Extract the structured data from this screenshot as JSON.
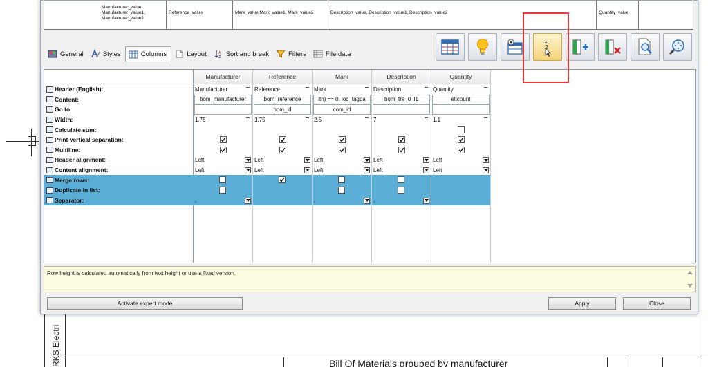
{
  "preview": {
    "manufacturer_value": "Manufacturer_value, Manufacturer_value1, Manufacturer_value2",
    "reference_value": "Reference_value",
    "mark_value": "Mark_value,Mark_value1, Mark_value2",
    "description_value": "Description_value, Description_value1, Description_value2",
    "quantity_value": "Quantity_value"
  },
  "tabs": [
    {
      "label": "General",
      "icon": "general-icon"
    },
    {
      "label": "Styles",
      "icon": "styles-icon"
    },
    {
      "label": "Columns",
      "icon": "columns-icon"
    },
    {
      "label": "Layout",
      "icon": "layout-icon"
    },
    {
      "label": "Sort and break",
      "icon": "sort-icon"
    },
    {
      "label": "Filters",
      "icon": "filter-icon"
    },
    {
      "label": "File data",
      "icon": "file-data-icon"
    }
  ],
  "toolbar": [
    {
      "name": "table-properties",
      "icon": "table-icon"
    },
    {
      "name": "tip",
      "icon": "lightbulb-icon"
    },
    {
      "name": "configure-columns",
      "icon": "column-config-icon"
    },
    {
      "name": "numbering",
      "icon": "numbering-icon",
      "numbers": [
        "1",
        "2",
        "3"
      ]
    },
    {
      "name": "add-column",
      "icon": "add-column-icon"
    },
    {
      "name": "delete-column",
      "icon": "delete-column-icon"
    },
    {
      "name": "preview",
      "icon": "preview-icon"
    },
    {
      "name": "zoom",
      "icon": "zoom-icon"
    }
  ],
  "row_labels": [
    "Header (English):",
    "Content:",
    "Go to:",
    "Width:",
    "Calculate sum:",
    "Print vertical separation:",
    "Multiline:",
    "Header alignment:",
    "Content alignment:",
    "Merge rows:",
    "Duplicate in list:",
    "Separator:"
  ],
  "columns": [
    {
      "header": "Manufacturer",
      "header_en": "Manufacturer",
      "content": "bom_manufacturer",
      "goto": "",
      "width": "1.75",
      "sum": null,
      "vsep": true,
      "multiline": true,
      "halign": "Left",
      "calign": "Left",
      "merge": false,
      "duplicate": false,
      "separator": ","
    },
    {
      "header": "Reference",
      "header_en": "Reference",
      "content": "bom_reference",
      "goto": "bom_id",
      "width": "1.75",
      "sum": null,
      "vsep": true,
      "multiline": true,
      "halign": "Left",
      "calign": "Left",
      "merge": true,
      "duplicate": null,
      "separator": ""
    },
    {
      "header": "Mark",
      "header_en": "Mark",
      "content": "ith) == 0, loc_tagpa",
      "goto": "com_id",
      "width": "2.5",
      "sum": null,
      "vsep": true,
      "multiline": true,
      "halign": "Left",
      "calign": "Left",
      "merge": false,
      "duplicate": false,
      "separator": ","
    },
    {
      "header": "Description",
      "header_en": "Description",
      "content": "bom_tra_0_l1",
      "goto": "",
      "width": "7",
      "sum": null,
      "vsep": true,
      "multiline": true,
      "halign": "Left",
      "calign": "Left",
      "merge": false,
      "duplicate": false,
      "separator": ","
    },
    {
      "header": "Quantity",
      "header_en": "Quantity",
      "content": "eltcount",
      "goto": "",
      "width": "1.1",
      "sum": false,
      "vsep": true,
      "multiline": true,
      "halign": "Left",
      "calign": "Left",
      "merge": null,
      "duplicate": null,
      "separator": ""
    }
  ],
  "hint": "Row height is calculated automatically from text height or use a fixed version.",
  "buttons": {
    "expert": "Activate expert mode",
    "apply": "Apply",
    "close": "Close"
  },
  "background": {
    "side_text": "RKS Electri",
    "bottom_title": "Bill Of Materials grouped by manufacturer"
  },
  "colors": {
    "selected_row": "#5aaed6",
    "highlight": "#e23c3c",
    "hint_bg": "#fdfbe0"
  }
}
